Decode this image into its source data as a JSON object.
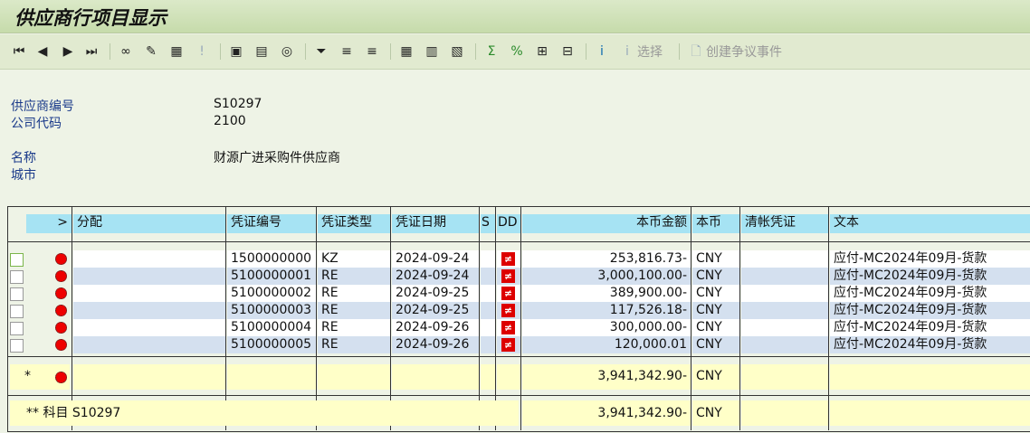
{
  "title": "供应商行项目显示",
  "toolbar": {
    "items": [
      {
        "icon": "first-page-icon",
        "glyph": "⏮"
      },
      {
        "icon": "previous-page-icon",
        "glyph": "◀"
      },
      {
        "icon": "next-page-icon",
        "glyph": "▶"
      },
      {
        "icon": "last-page-icon",
        "glyph": "⏭"
      },
      {
        "icon": "glasses-icon",
        "glyph": "∞"
      },
      {
        "icon": "pencil-icon",
        "glyph": "✎"
      },
      {
        "icon": "select-columns-icon",
        "glyph": "▦"
      },
      {
        "icon": "exception-icon",
        "glyph": "!",
        "disabled": true
      },
      {
        "icon": "document-overview-icon",
        "glyph": "▣"
      },
      {
        "icon": "master-record-icon",
        "glyph": "▤"
      },
      {
        "icon": "display-document-icon",
        "glyph": "◎"
      },
      {
        "icon": "filter-icon",
        "glyph": "⏷"
      },
      {
        "icon": "sort-ascending-icon",
        "glyph": "≡"
      },
      {
        "icon": "sort-descending-icon",
        "glyph": "≡"
      },
      {
        "icon": "layout-icon",
        "glyph": "▦"
      },
      {
        "icon": "change-layout-icon",
        "glyph": "▥"
      },
      {
        "icon": "save-layout-icon",
        "glyph": "▧"
      },
      {
        "icon": "sum-icon",
        "glyph": "Σ"
      },
      {
        "icon": "subtotal-icon",
        "glyph": "%"
      },
      {
        "icon": "expand-icon",
        "glyph": "⊞"
      },
      {
        "icon": "collapse-icon",
        "glyph": "⊟"
      },
      {
        "icon": "info-icon",
        "glyph": "i"
      },
      {
        "icon": "selection-info-icon",
        "glyph": "i",
        "label": "选择",
        "disabled": true
      },
      {
        "icon": "document-icon",
        "glyph": "🗋",
        "label": "创建争议事件",
        "disabled": true
      }
    ]
  },
  "header": {
    "vendor_label": "供应商编号",
    "vendor": "S10297",
    "company_label": "公司代码",
    "company": "2100",
    "name_label": "名称",
    "name": "财源广进采购件供应商",
    "city_label": "城市"
  },
  "columns": {
    "expand": ">",
    "assignment": "分配",
    "doc_no": "凭证编号",
    "doc_type": "凭证类型",
    "doc_date": "凭证日期",
    "s": "S",
    "dd": "DD",
    "amount": "本币金额",
    "currency": "本币",
    "clearing": "清帐凭证",
    "text": "文本"
  },
  "rows": [
    {
      "doc_no": "1500000000",
      "doc_type": "KZ",
      "doc_date": "2024-09-24",
      "amount": "253,816.73-",
      "currency": "CNY",
      "text": "应付-MC2024年09月-货款"
    },
    {
      "doc_no": "5100000001",
      "doc_type": "RE",
      "doc_date": "2024-09-24",
      "amount": "3,000,100.00-",
      "currency": "CNY",
      "text": "应付-MC2024年09月-货款"
    },
    {
      "doc_no": "5100000002",
      "doc_type": "RE",
      "doc_date": "2024-09-25",
      "amount": "389,900.00-",
      "currency": "CNY",
      "text": "应付-MC2024年09月-货款"
    },
    {
      "doc_no": "5100000003",
      "doc_type": "RE",
      "doc_date": "2024-09-25",
      "amount": "117,526.18-",
      "currency": "CNY",
      "text": "应付-MC2024年09月-货款"
    },
    {
      "doc_no": "5100000004",
      "doc_type": "RE",
      "doc_date": "2024-09-26",
      "amount": "300,000.00-",
      "currency": "CNY",
      "text": "应付-MC2024年09月-货款"
    },
    {
      "doc_no": "5100000005",
      "doc_type": "RE",
      "doc_date": "2024-09-26",
      "amount": "120,000.01",
      "currency": "CNY",
      "text": "应付-MC2024年09月-货款"
    }
  ],
  "total": {
    "marker": "*",
    "amount": "3,941,342.90-",
    "currency": "CNY"
  },
  "account_total": {
    "label": "** 科目 S10297",
    "amount": "3,941,342.90-",
    "currency": "CNY"
  },
  "colors": {
    "header": "#a6e3f3",
    "alt_row": "#d4e0ef",
    "total_row": "#ffffc8",
    "status_red": "#e00000"
  }
}
